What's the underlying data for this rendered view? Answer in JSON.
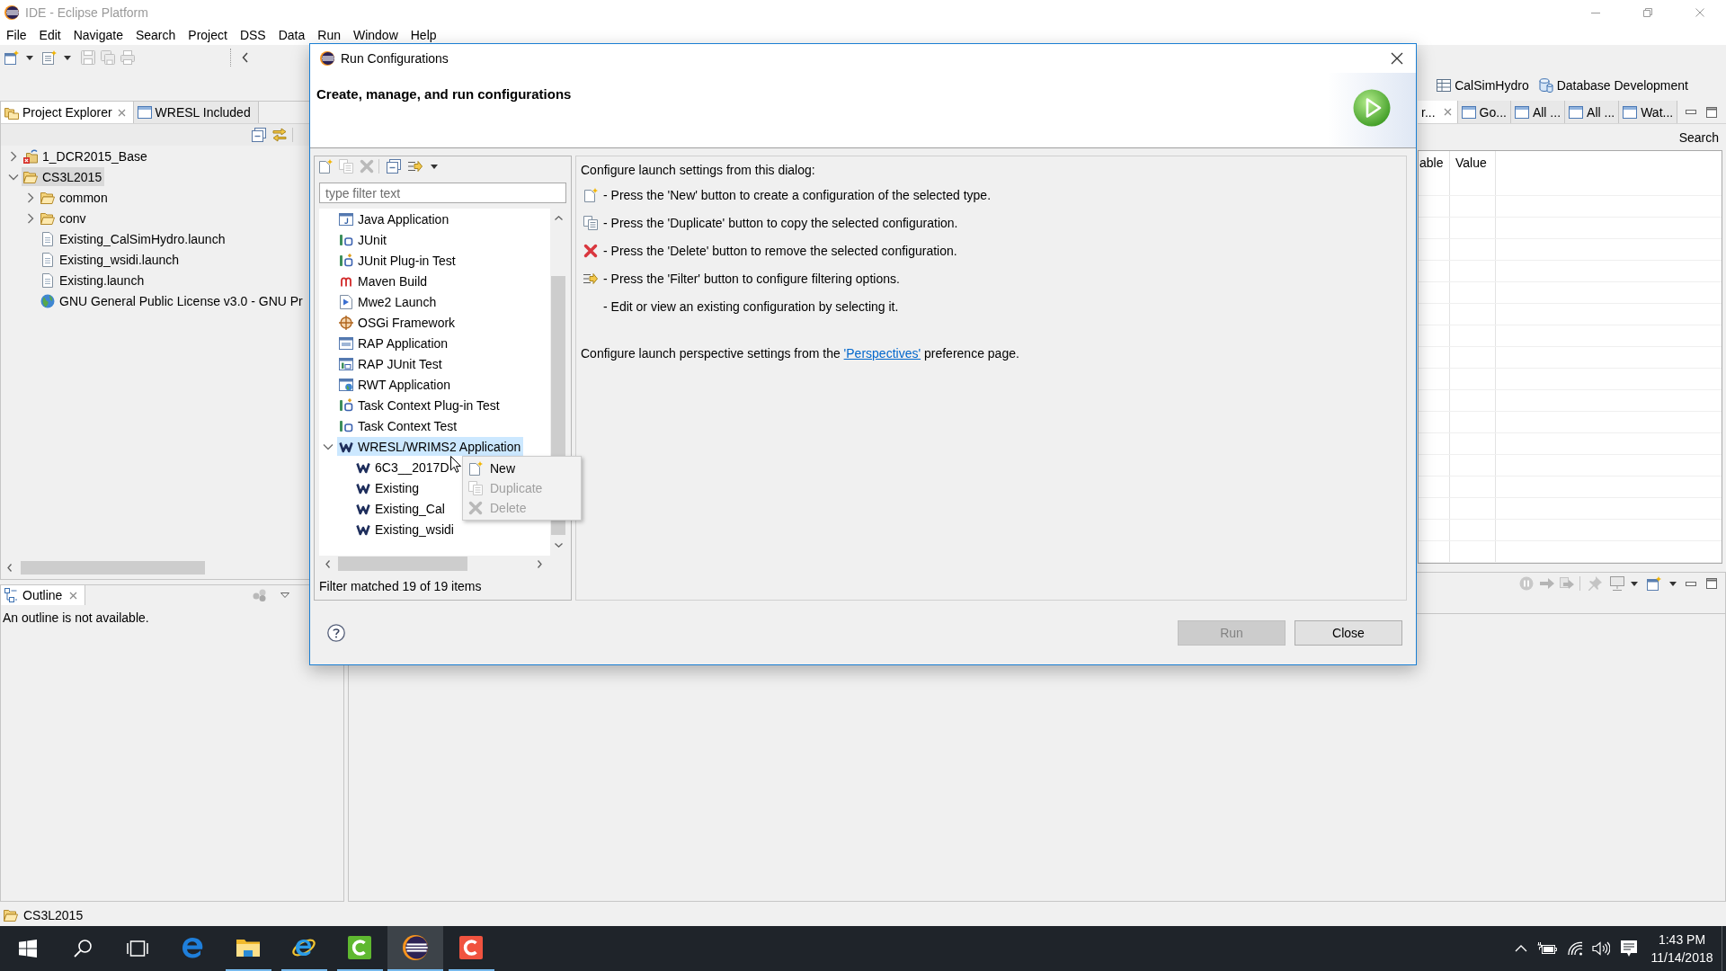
{
  "window": {
    "title": "IDE - Eclipse Platform"
  },
  "menu_bar": [
    "File",
    "Edit",
    "Navigate",
    "Search",
    "Project",
    "DSS",
    "Data",
    "Run",
    "Window",
    "Help"
  ],
  "toolbar": [
    {
      "disabled": false
    },
    {
      "disabled": false
    },
    {
      "disabled": true
    },
    {
      "disabled": true
    },
    {
      "disabled": true
    }
  ],
  "perspectives": [
    "CalSimHydro",
    "Database Development"
  ],
  "project_explorer": {
    "tabs": [
      {
        "label": "Project Explorer",
        "selected": true
      },
      {
        "label": "WRESL Included",
        "selected": false
      }
    ],
    "tree": [
      {
        "label": "1_DCR2015_Base",
        "kind": "project",
        "expanded": false,
        "selected": false
      },
      {
        "label": "CS3L2015",
        "kind": "folder",
        "expanded": true,
        "selected": true,
        "children": [
          {
            "label": "common",
            "kind": "folder",
            "expanded": false,
            "selected": false
          },
          {
            "label": "conv",
            "kind": "folder",
            "expanded": false,
            "selected": false
          },
          {
            "label": "Existing_CalSimHydro.launch",
            "kind": "file",
            "selected": false
          },
          {
            "label": "Existing_wsidi.launch",
            "kind": "file",
            "selected": false
          },
          {
            "label": "Existing.launch",
            "kind": "file",
            "selected": false
          },
          {
            "label": "GNU General Public License v3.0 - GNU Pr",
            "kind": "link",
            "selected": false
          }
        ]
      }
    ]
  },
  "outline": {
    "tab": {
      "label": "Outline",
      "selected": true
    },
    "message": "An outline is not available."
  },
  "right_panel": {
    "tabs": [
      {
        "label": "r...",
        "selected": true
      },
      {
        "label": "Go...",
        "selected": false
      },
      {
        "label": "All ...",
        "selected": false
      },
      {
        "label": "All ...",
        "selected": false
      },
      {
        "label": "Wat...",
        "selected": false
      }
    ],
    "search": "Search",
    "columns": [
      "able",
      "Value"
    ]
  },
  "status_bar": {
    "text": "CS3L2015"
  },
  "dialog": {
    "title": "Run Configurations",
    "heading": "Create, manage, and run configurations",
    "toolbar": [
      {
        "disabled": false
      },
      {
        "disabled": true
      },
      {
        "disabled": true
      },
      {
        "disabled": false
      },
      {
        "disabled": false
      }
    ],
    "filter": {
      "placeholder": "type filter text"
    },
    "tree": [
      {
        "label": "Java Application",
        "kind": "java",
        "selected": false
      },
      {
        "label": "JUnit",
        "kind": "junit",
        "selected": false
      },
      {
        "label": "JUnit Plug-in Test",
        "kind": "junitplugin",
        "selected": false
      },
      {
        "label": "Maven Build",
        "kind": "maven",
        "selected": false
      },
      {
        "label": "Mwe2 Launch",
        "kind": "mwe2",
        "selected": false
      },
      {
        "label": "OSGi Framework",
        "kind": "osgi",
        "selected": false
      },
      {
        "label": "RAP Application",
        "kind": "rap",
        "selected": false
      },
      {
        "label": "RAP JUnit Test",
        "kind": "rapjunit",
        "selected": false
      },
      {
        "label": "RWT Application",
        "kind": "rwt",
        "selected": false
      },
      {
        "label": "Task Context Plug-in Test",
        "kind": "taskplugin",
        "selected": false
      },
      {
        "label": "Task Context Test",
        "kind": "tasktest",
        "selected": false
      },
      {
        "label": "WRESL/WRIMS2 Application",
        "kind": "wresl",
        "selected": true,
        "expanded": true,
        "children": [
          {
            "label": "6C3__2017D",
            "kind": "wresl",
            "selected": false
          },
          {
            "label": "Existing",
            "kind": "wresl",
            "selected": false
          },
          {
            "label": "Existing_Cal",
            "kind": "wresl",
            "selected": false
          },
          {
            "label": "Existing_wsidi",
            "kind": "wresl",
            "selected": false
          }
        ]
      }
    ],
    "filter_status": "Filter matched 19 of 19 items",
    "context_menu": [
      {
        "label": "New",
        "disabled": false
      },
      {
        "label": "Duplicate",
        "disabled": true
      },
      {
        "label": "Delete",
        "disabled": true
      }
    ],
    "intro": "Configure launch settings from this dialog:",
    "hints": [
      "- Press the 'New' button to create a configuration of the selected type.",
      "- Press the 'Duplicate' button to copy the selected configuration.",
      "- Press the 'Delete' button to remove the selected configuration.",
      "- Press the 'Filter' button to configure filtering options.",
      "- Edit or view an existing configuration by selecting it."
    ],
    "note": {
      "text_before": "Configure launch perspective settings from the ",
      "link": "'Perspectives'",
      "text_after": " preference page."
    },
    "buttons": [
      {
        "label": "Run",
        "disabled": true
      },
      {
        "label": "Close",
        "disabled": false
      }
    ]
  },
  "taskbar": {
    "apps": [
      {
        "running": false,
        "selected": false
      },
      {
        "running": true,
        "selected": false
      },
      {
        "running": true,
        "selected": false
      },
      {
        "running": true,
        "selected": false
      },
      {
        "running": true,
        "selected": true
      },
      {
        "running": true,
        "selected": false
      }
    ],
    "time": "1:43 PM",
    "date": "11/14/2018"
  }
}
